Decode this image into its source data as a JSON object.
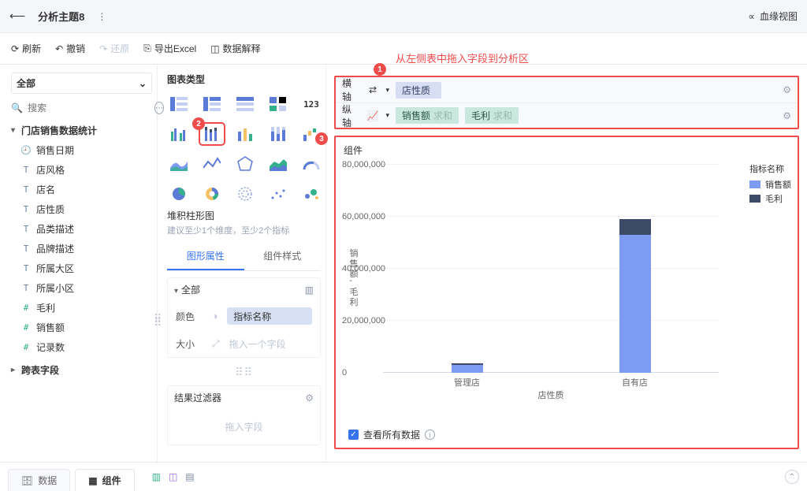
{
  "header": {
    "title": "分析主题8",
    "lineage": "血缘视图"
  },
  "toolbar": {
    "refresh": "刷新",
    "undo": "撤销",
    "redo": "还原",
    "exportExcel": "导出Excel",
    "interpret": "数据解释"
  },
  "sidebar": {
    "all": "全部",
    "search_placeholder": "搜索",
    "table_name": "门店销售数据统计",
    "fields": [
      {
        "type": "clock",
        "label": "销售日期"
      },
      {
        "type": "T",
        "label": "店风格"
      },
      {
        "type": "T",
        "label": "店名"
      },
      {
        "type": "T",
        "label": "店性质"
      },
      {
        "type": "T",
        "label": "品类描述"
      },
      {
        "type": "T",
        "label": "品牌描述"
      },
      {
        "type": "T",
        "label": "所属大区"
      },
      {
        "type": "T",
        "label": "所属小区"
      },
      {
        "type": "hash",
        "label": "毛利"
      },
      {
        "type": "hash",
        "label": "销售额"
      },
      {
        "type": "hash",
        "label": "记录数"
      }
    ],
    "cross_fields": "跨表字段"
  },
  "chartTypes": {
    "title": "图表类型",
    "selected_name": "堆积柱形图",
    "hint": "建议至少1个维度，至少2个指标"
  },
  "subTabs": {
    "prop": "图形属性",
    "style": "组件样式"
  },
  "attrs": {
    "all": "全部",
    "color": "颜色",
    "color_value": "指标名称",
    "size": "大小",
    "size_placeholder": "拖入一个字段"
  },
  "filter": {
    "title": "结果过滤器",
    "placeholder": "拖入字段"
  },
  "instruction": "从左侧表中拖入字段到分析区",
  "axes": {
    "x_label": "横轴",
    "y_label": "纵轴",
    "x_fields": [
      {
        "name": "店性质"
      }
    ],
    "y_fields": [
      {
        "name": "销售额",
        "agg": "求和"
      },
      {
        "name": "毛利",
        "agg": "求和"
      }
    ]
  },
  "component": {
    "title": "组件",
    "view_all": "查看所有数据",
    "legend_title": "指标名称",
    "legend_items": [
      "销售额",
      "毛利"
    ]
  },
  "bottomTabs": {
    "data": "数据",
    "component": "组件"
  },
  "badges": {
    "b1": "1",
    "b2": "2",
    "b3": "3"
  },
  "colors": {
    "series_sales": "#7d9bf3",
    "series_profit": "#3d4a68"
  },
  "chart_data": {
    "type": "bar",
    "stacked": true,
    "categories": [
      "管理店",
      "自有店"
    ],
    "series": [
      {
        "name": "销售额",
        "values": [
          3000000,
          53000000
        ]
      },
      {
        "name": "毛利",
        "values": [
          500000,
          6000000
        ]
      }
    ],
    "xlabel": "店性质",
    "ylabel": "销售额, 毛利",
    "ylim": [
      0,
      80000000
    ],
    "yticks": [
      0,
      20000000,
      40000000,
      60000000,
      80000000
    ],
    "ytick_labels": [
      "0",
      "20,000,000",
      "40,000,000",
      "60,000,000",
      "80,000,000"
    ]
  }
}
